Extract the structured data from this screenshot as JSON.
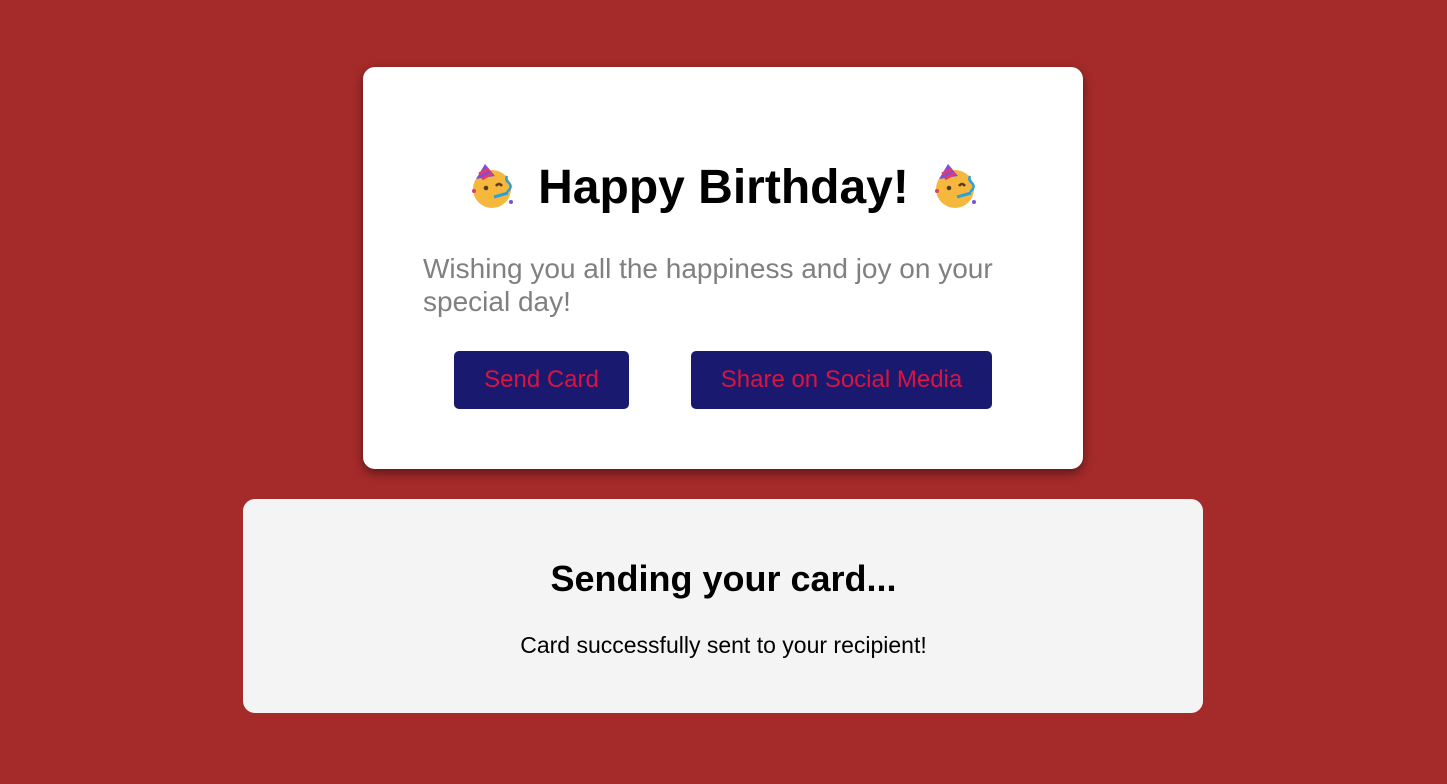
{
  "card": {
    "title": "Happy Birthday!",
    "title_icon": "partying-face-emoji",
    "subtitle": "Wishing you all the happiness and joy on your special day!",
    "send_button_label": "Send Card",
    "share_button_label": "Share on Social Media"
  },
  "status": {
    "title": "Sending your card...",
    "message": "Card successfully sent to your recipient!"
  },
  "colors": {
    "page_background": "#a52a2a",
    "button_background": "#191970",
    "button_text": "#dc143c",
    "subtitle_text": "#808080",
    "status_panel_background": "#f4f4f4"
  }
}
